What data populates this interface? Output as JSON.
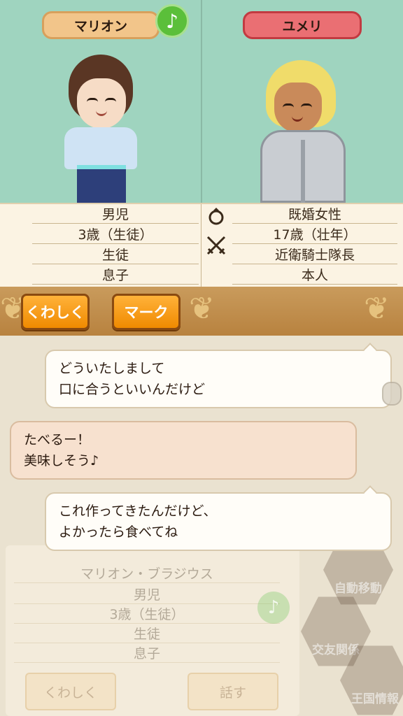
{
  "left_character": {
    "name": "マリオン",
    "rows": [
      "男児",
      "3歳（生徒）",
      "生徒",
      "息子"
    ]
  },
  "right_character": {
    "name": "ユメリ",
    "rows": [
      "既婚女性",
      "17歳（壮年）",
      "近衛騎士隊長",
      "本人"
    ]
  },
  "music_icon": "♪",
  "buttons": {
    "details_label": "くわしく",
    "mark_label": "マーク"
  },
  "messages": [
    {
      "speaker": "right",
      "lines": [
        "どういたしまして",
        "口に合うといいんだけど"
      ]
    },
    {
      "speaker": "left",
      "lines": [
        "たべるー！",
        "美味しそう♪"
      ]
    },
    {
      "speaker": "right",
      "lines": [
        "これ作ってきたんだけど、",
        "よかったら食べてね"
      ]
    }
  ],
  "background_panel": {
    "full_name": "マリオン・ブラジウス",
    "rows": [
      "男児",
      "3歳（生徒）",
      "生徒",
      "息子"
    ],
    "details_label": "くわしく",
    "talk_label": "話す"
  },
  "background_menu": {
    "auto_move": "自動移動",
    "relations": "交友関係",
    "kingdom_info": "王国情報"
  },
  "colors": {
    "portrait_bg": "#9fd4bf",
    "left_tag": "#f2c58a",
    "right_tag": "#ea6f73",
    "button_orange": "#f08a00"
  }
}
